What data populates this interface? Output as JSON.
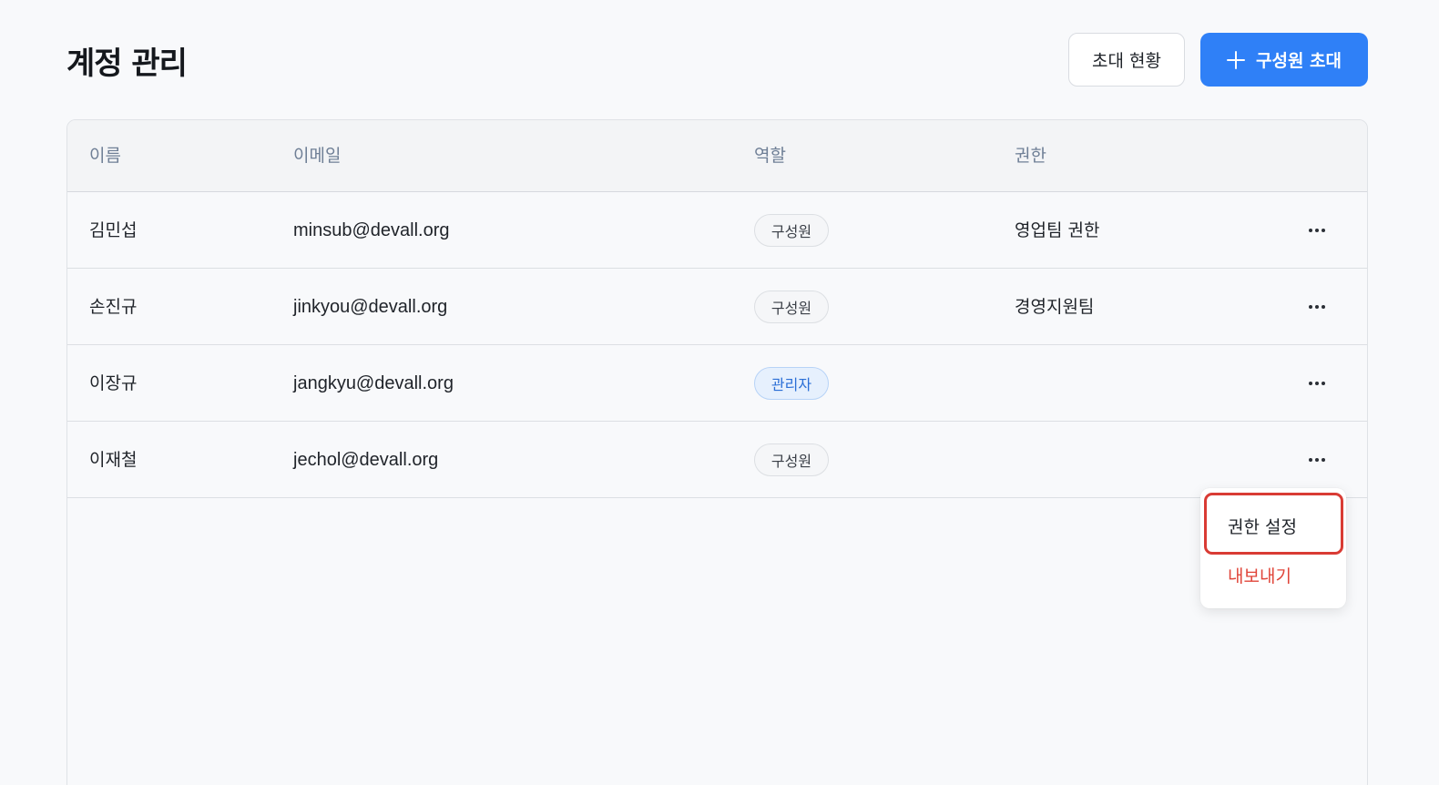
{
  "header": {
    "title": "계정 관리",
    "invite_status_label": "초대 현황",
    "invite_member_label": "구성원 초대"
  },
  "table": {
    "columns": [
      "이름",
      "이메일",
      "역할",
      "권한"
    ],
    "rows": [
      {
        "name": "김민섭",
        "email": "minsub@devall.org",
        "role": "구성원",
        "permission": "영업팀 권한"
      },
      {
        "name": "손진규",
        "email": "jinkyou@devall.org",
        "role": "구성원",
        "permission": "경영지원팀"
      },
      {
        "name": "이장규",
        "email": "jangkyu@devall.org",
        "role": "관리자",
        "permission": ""
      },
      {
        "name": "이재철",
        "email": "jechol@devall.org",
        "role": "구성원",
        "permission": ""
      }
    ]
  },
  "context_menu": {
    "permission_settings_label": "권한 설정",
    "export_label": "내보내기"
  },
  "colors": {
    "primary": "#2f80f7",
    "danger": "#e0453a",
    "highlight": "#d93b34",
    "admin_badge_text": "#2b6fd6"
  },
  "icons": {
    "invite_button": "plus-icon",
    "row_action": "more-horizontal-icon"
  }
}
